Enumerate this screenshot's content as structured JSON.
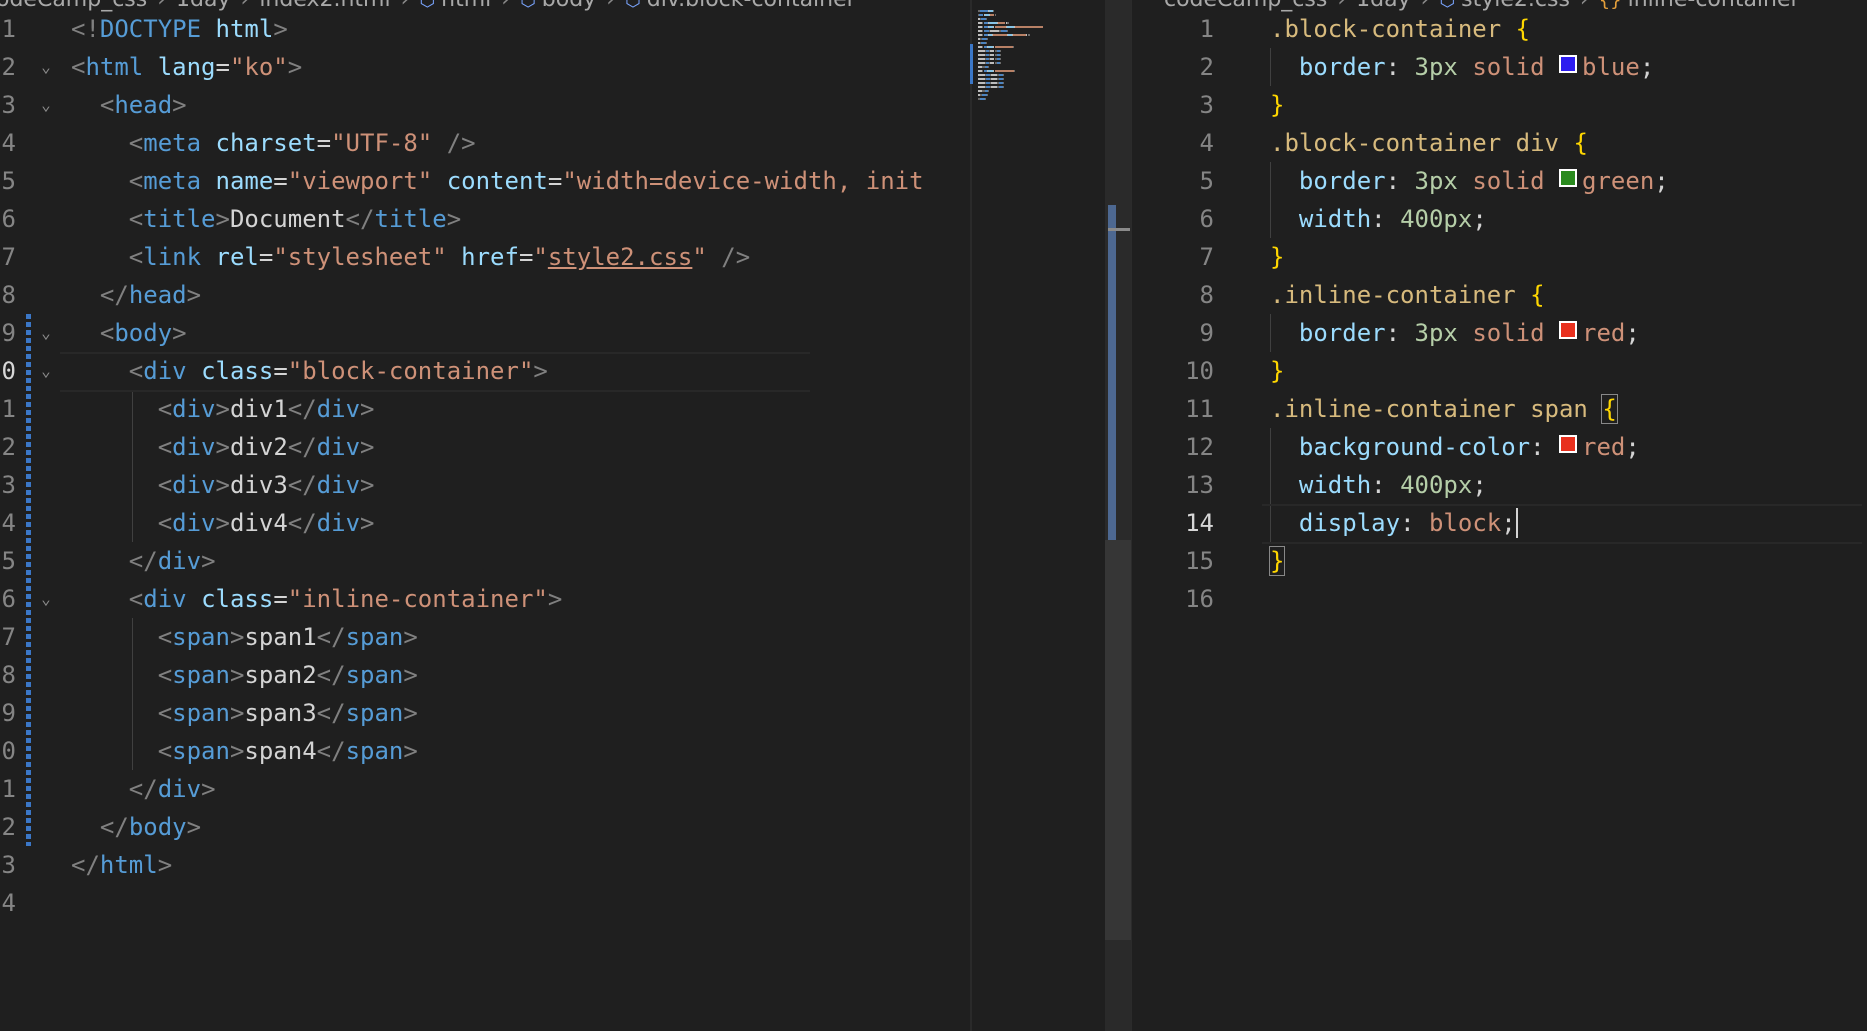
{
  "left_editor": {
    "breadcrumb": [
      "odeCamp_css",
      "1day",
      "index2.html",
      "html",
      "body",
      "div.block-container"
    ],
    "line_numbers": [
      "1",
      "2",
      "3",
      "4",
      "5",
      "6",
      "7",
      "8",
      "9",
      "0",
      "1",
      "2",
      "3",
      "4",
      "5",
      "6",
      "7",
      "8",
      "9",
      "0",
      "1",
      "2",
      "3",
      "4"
    ],
    "lines": [
      [
        [
          "p",
          "<!"
        ],
        [
          "t",
          "DOCTYPE"
        ],
        [
          "x",
          " "
        ],
        [
          "a",
          "html"
        ],
        [
          "p",
          ">"
        ]
      ],
      [
        [
          "p",
          "<"
        ],
        [
          "t",
          "html"
        ],
        [
          "x",
          " "
        ],
        [
          "a",
          "lang"
        ],
        [
          "x",
          "="
        ],
        [
          "s",
          "\"ko\""
        ],
        [
          "p",
          ">"
        ]
      ],
      [
        [
          "x",
          "  "
        ],
        [
          "p",
          "<"
        ],
        [
          "t",
          "head"
        ],
        [
          "p",
          ">"
        ]
      ],
      [
        [
          "x",
          "    "
        ],
        [
          "p",
          "<"
        ],
        [
          "t",
          "meta"
        ],
        [
          "x",
          " "
        ],
        [
          "a",
          "charset"
        ],
        [
          "x",
          "="
        ],
        [
          "s",
          "\"UTF-8\""
        ],
        [
          "x",
          " "
        ],
        [
          "p",
          "/>"
        ]
      ],
      [
        [
          "x",
          "    "
        ],
        [
          "p",
          "<"
        ],
        [
          "t",
          "meta"
        ],
        [
          "x",
          " "
        ],
        [
          "a",
          "name"
        ],
        [
          "x",
          "="
        ],
        [
          "s",
          "\"viewport\""
        ],
        [
          "x",
          " "
        ],
        [
          "a",
          "content"
        ],
        [
          "x",
          "="
        ],
        [
          "s",
          "\"width=device-width, init"
        ]
      ],
      [
        [
          "x",
          "    "
        ],
        [
          "p",
          "<"
        ],
        [
          "t",
          "title"
        ],
        [
          "p",
          ">"
        ],
        [
          "x",
          "Document"
        ],
        [
          "p",
          "</"
        ],
        [
          "t",
          "title"
        ],
        [
          "p",
          ">"
        ]
      ],
      [
        [
          "x",
          "    "
        ],
        [
          "p",
          "<"
        ],
        [
          "t",
          "link"
        ],
        [
          "x",
          " "
        ],
        [
          "a",
          "rel"
        ],
        [
          "x",
          "="
        ],
        [
          "s",
          "\"stylesheet\""
        ],
        [
          "x",
          " "
        ],
        [
          "a",
          "href"
        ],
        [
          "x",
          "="
        ],
        [
          "s",
          "\""
        ],
        [
          "u",
          "style2.css"
        ],
        [
          "s",
          "\""
        ],
        [
          "x",
          " "
        ],
        [
          "p",
          "/>"
        ]
      ],
      [
        [
          "x",
          "  "
        ],
        [
          "p",
          "</"
        ],
        [
          "t",
          "head"
        ],
        [
          "p",
          ">"
        ]
      ],
      [
        [
          "x",
          "  "
        ],
        [
          "p",
          "<"
        ],
        [
          "t",
          "body"
        ],
        [
          "p",
          ">"
        ]
      ],
      [
        [
          "x",
          "    "
        ],
        [
          "p",
          "<"
        ],
        [
          "t",
          "div"
        ],
        [
          "x",
          " "
        ],
        [
          "a",
          "class"
        ],
        [
          "x",
          "="
        ],
        [
          "s",
          "\"block-container\""
        ],
        [
          "p",
          ">"
        ]
      ],
      [
        [
          "x",
          "      "
        ],
        [
          "p",
          "<"
        ],
        [
          "t",
          "div"
        ],
        [
          "p",
          ">"
        ],
        [
          "x",
          "div1"
        ],
        [
          "p",
          "</"
        ],
        [
          "t",
          "div"
        ],
        [
          "p",
          ">"
        ]
      ],
      [
        [
          "x",
          "      "
        ],
        [
          "p",
          "<"
        ],
        [
          "t",
          "div"
        ],
        [
          "p",
          ">"
        ],
        [
          "x",
          "div2"
        ],
        [
          "p",
          "</"
        ],
        [
          "t",
          "div"
        ],
        [
          "p",
          ">"
        ]
      ],
      [
        [
          "x",
          "      "
        ],
        [
          "p",
          "<"
        ],
        [
          "t",
          "div"
        ],
        [
          "p",
          ">"
        ],
        [
          "x",
          "div3"
        ],
        [
          "p",
          "</"
        ],
        [
          "t",
          "div"
        ],
        [
          "p",
          ">"
        ]
      ],
      [
        [
          "x",
          "      "
        ],
        [
          "p",
          "<"
        ],
        [
          "t",
          "div"
        ],
        [
          "p",
          ">"
        ],
        [
          "x",
          "div4"
        ],
        [
          "p",
          "</"
        ],
        [
          "t",
          "div"
        ],
        [
          "p",
          ">"
        ]
      ],
      [
        [
          "x",
          "    "
        ],
        [
          "p",
          "</"
        ],
        [
          "t",
          "div"
        ],
        [
          "p",
          ">"
        ]
      ],
      [
        [
          "x",
          "    "
        ],
        [
          "p",
          "<"
        ],
        [
          "t",
          "div"
        ],
        [
          "x",
          " "
        ],
        [
          "a",
          "class"
        ],
        [
          "x",
          "="
        ],
        [
          "s",
          "\"inline-container\""
        ],
        [
          "p",
          ">"
        ]
      ],
      [
        [
          "x",
          "      "
        ],
        [
          "p",
          "<"
        ],
        [
          "t",
          "span"
        ],
        [
          "p",
          ">"
        ],
        [
          "x",
          "span1"
        ],
        [
          "p",
          "</"
        ],
        [
          "t",
          "span"
        ],
        [
          "p",
          ">"
        ]
      ],
      [
        [
          "x",
          "      "
        ],
        [
          "p",
          "<"
        ],
        [
          "t",
          "span"
        ],
        [
          "p",
          ">"
        ],
        [
          "x",
          "span2"
        ],
        [
          "p",
          "</"
        ],
        [
          "t",
          "span"
        ],
        [
          "p",
          ">"
        ]
      ],
      [
        [
          "x",
          "      "
        ],
        [
          "p",
          "<"
        ],
        [
          "t",
          "span"
        ],
        [
          "p",
          ">"
        ],
        [
          "x",
          "span3"
        ],
        [
          "p",
          "</"
        ],
        [
          "t",
          "span"
        ],
        [
          "p",
          ">"
        ]
      ],
      [
        [
          "x",
          "      "
        ],
        [
          "p",
          "<"
        ],
        [
          "t",
          "span"
        ],
        [
          "p",
          ">"
        ],
        [
          "x",
          "span4"
        ],
        [
          "p",
          "</"
        ],
        [
          "t",
          "span"
        ],
        [
          "p",
          ">"
        ]
      ],
      [
        [
          "x",
          "    "
        ],
        [
          "p",
          "</"
        ],
        [
          "t",
          "div"
        ],
        [
          "p",
          ">"
        ]
      ],
      [
        [
          "x",
          "  "
        ],
        [
          "p",
          "</"
        ],
        [
          "t",
          "body"
        ],
        [
          "p",
          ">"
        ]
      ],
      [
        [
          "p",
          "</"
        ],
        [
          "t",
          "html"
        ],
        [
          "p",
          ">"
        ]
      ],
      []
    ],
    "fold_lines": [
      1,
      2,
      8,
      9,
      15
    ],
    "active_line": 9
  },
  "right_editor": {
    "breadcrumb": [
      "codeCamp_css",
      "1day",
      "style2.css",
      "inline-container"
    ],
    "line_numbers": [
      "1",
      "2",
      "3",
      "4",
      "5",
      "6",
      "7",
      "8",
      "9",
      "10",
      "11",
      "12",
      "13",
      "14",
      "15",
      "16"
    ],
    "lines": [
      [
        [
          "sel",
          ".block-container"
        ],
        [
          "x",
          " "
        ],
        [
          "b",
          "{"
        ]
      ],
      [
        [
          "x",
          "  "
        ],
        [
          "pr",
          "border"
        ],
        [
          "x",
          ": "
        ],
        [
          "n",
          "3px"
        ],
        [
          "x",
          " "
        ],
        [
          "v",
          "solid"
        ],
        [
          "x",
          " "
        ],
        [
          "sw",
          "#2d1cf0"
        ],
        [
          "v",
          "blue"
        ],
        [
          "x",
          ";"
        ]
      ],
      [
        [
          "b",
          "}"
        ]
      ],
      [
        [
          "sel",
          ".block-container div"
        ],
        [
          "x",
          " "
        ],
        [
          "b",
          "{"
        ]
      ],
      [
        [
          "x",
          "  "
        ],
        [
          "pr",
          "border"
        ],
        [
          "x",
          ": "
        ],
        [
          "n",
          "3px"
        ],
        [
          "x",
          " "
        ],
        [
          "v",
          "solid"
        ],
        [
          "x",
          " "
        ],
        [
          "sw",
          "#2a8a1e"
        ],
        [
          "v",
          "green"
        ],
        [
          "x",
          ";"
        ]
      ],
      [
        [
          "x",
          "  "
        ],
        [
          "pr",
          "width"
        ],
        [
          "x",
          ": "
        ],
        [
          "n",
          "400px"
        ],
        [
          "x",
          ";"
        ]
      ],
      [
        [
          "b",
          "}"
        ]
      ],
      [
        [
          "sel",
          ".inline-container"
        ],
        [
          "x",
          " "
        ],
        [
          "b",
          "{"
        ]
      ],
      [
        [
          "x",
          "  "
        ],
        [
          "pr",
          "border"
        ],
        [
          "x",
          ": "
        ],
        [
          "n",
          "3px"
        ],
        [
          "x",
          " "
        ],
        [
          "v",
          "solid"
        ],
        [
          "x",
          " "
        ],
        [
          "sw",
          "#e8301e"
        ],
        [
          "v",
          "red"
        ],
        [
          "x",
          ";"
        ]
      ],
      [
        [
          "b",
          "}"
        ]
      ],
      [
        [
          "sel",
          ".inline-container span"
        ],
        [
          "x",
          " "
        ],
        [
          "bm",
          "{"
        ]
      ],
      [
        [
          "x",
          "  "
        ],
        [
          "pr",
          "background-color"
        ],
        [
          "x",
          ": "
        ],
        [
          "sw",
          "#e8301e"
        ],
        [
          "v",
          "red"
        ],
        [
          "x",
          ";"
        ]
      ],
      [
        [
          "x",
          "  "
        ],
        [
          "pr",
          "width"
        ],
        [
          "x",
          ": "
        ],
        [
          "n",
          "400px"
        ],
        [
          "x",
          ";"
        ]
      ],
      [
        [
          "x",
          "  "
        ],
        [
          "pr",
          "display"
        ],
        [
          "x",
          ": "
        ],
        [
          "v",
          "block"
        ],
        [
          "x",
          ";"
        ],
        [
          "c",
          ""
        ]
      ],
      [
        [
          "bm",
          "}"
        ]
      ],
      []
    ],
    "active_line": 13
  }
}
